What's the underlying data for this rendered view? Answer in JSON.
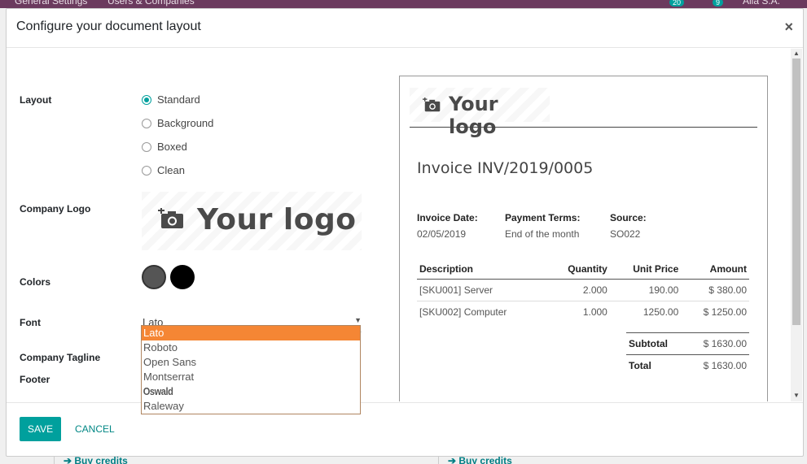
{
  "background": {
    "nav_items": [
      "General Settings",
      "Users & Companies"
    ],
    "activity_count": "20",
    "message_count": "9",
    "user_name": "Alia S.A.",
    "buy_credits": "➔ Buy credits"
  },
  "modal": {
    "title": "Configure your document layout",
    "close_label": "×"
  },
  "form": {
    "layout_label": "Layout",
    "layout_options": [
      "Standard",
      "Background",
      "Boxed",
      "Clean"
    ],
    "layout_selected": "Standard",
    "logo_label": "Company Logo",
    "logo_text": "Your logo",
    "colors_label": "Colors",
    "colors": [
      "#555555",
      "#000000"
    ],
    "font_label": "Font",
    "font_value": "Lato",
    "font_options": [
      "Lato",
      "Roboto",
      "Open Sans",
      "Montserrat",
      "Oswald",
      "Raleway"
    ],
    "tagline_label": "Company Tagline",
    "footer_label": "Footer"
  },
  "preview": {
    "logo_text": "Your logo",
    "invoice_title": "Invoice INV/2019/0005",
    "meta": [
      {
        "label": "Invoice Date:",
        "value": "02/05/2019"
      },
      {
        "label": "Payment Terms:",
        "value": "End of the month"
      },
      {
        "label": "Source:",
        "value": "SO022"
      }
    ],
    "columns": [
      "Description",
      "Quantity",
      "Unit Price",
      "Amount"
    ],
    "rows": [
      {
        "description": "[SKU001] Server",
        "quantity": "2.000",
        "unit_price": "190.00",
        "amount": "$ 380.00"
      },
      {
        "description": "[SKU002] Computer",
        "quantity": "1.000",
        "unit_price": "1250.00",
        "amount": "$ 1250.00"
      }
    ],
    "subtotal_label": "Subtotal",
    "subtotal_value": "$ 1630.00",
    "total_label": "Total",
    "total_value": "$ 1630.00"
  },
  "footer": {
    "save_label": "Save",
    "cancel_label": "Cancel"
  },
  "colors": {
    "accent": "#00a09d",
    "dropdown_highlight": "#f58634",
    "topbar": "#6b3a5e"
  }
}
